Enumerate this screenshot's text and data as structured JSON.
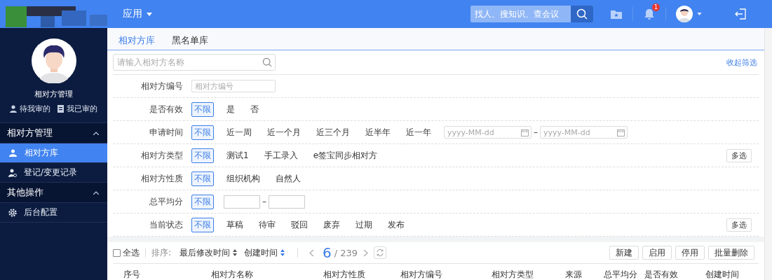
{
  "topbar": {
    "menu": "应用",
    "search_placeholder": "找人、搜知识、查会议",
    "notification_count": "1"
  },
  "sidebar": {
    "title": "相对方管理",
    "links": [
      "待我审的",
      "我已审的"
    ],
    "groups": [
      {
        "label": "相对方管理",
        "expanded": true,
        "items": [
          {
            "label": "相对方库",
            "selected": true
          },
          {
            "label": "登记/变更记录",
            "selected": false
          }
        ]
      },
      {
        "label": "其他操作",
        "expanded": true,
        "items": [
          {
            "label": "后台配置",
            "selected": false
          }
        ]
      }
    ]
  },
  "tabs": [
    {
      "label": "相对方库",
      "selected": true
    },
    {
      "label": "黑名单库",
      "selected": false
    }
  ],
  "search": {
    "placeholder": "请输入相对方名称"
  },
  "collapse_link": "收起筛选",
  "filters": [
    {
      "kind": "input",
      "label": "相对方编号",
      "placeholder": "相对方编号"
    },
    {
      "kind": "options",
      "label": "是否有效",
      "options": [
        {
          "label": "不限",
          "selected": true
        },
        {
          "label": "是",
          "selected": false
        },
        {
          "label": "否",
          "selected": false
        }
      ]
    },
    {
      "kind": "date",
      "label": "申请时间",
      "options": [
        {
          "label": "不限",
          "selected": true
        },
        {
          "label": "近一周",
          "selected": false
        },
        {
          "label": "近一个月",
          "selected": false
        },
        {
          "label": "近三个月",
          "selected": false
        },
        {
          "label": "近半年",
          "selected": false
        },
        {
          "label": "近一年",
          "selected": false
        }
      ],
      "from_placeholder": "yyyy-MM-dd",
      "separator": "–",
      "to_placeholder": "yyyy-MM-dd"
    },
    {
      "kind": "options",
      "label": "相对方类型",
      "options": [
        {
          "label": "不限",
          "selected": true
        },
        {
          "label": "测试1",
          "selected": false
        },
        {
          "label": "手工录入",
          "selected": false
        },
        {
          "label": "e签宝同步相对方",
          "selected": false
        }
      ],
      "multi_button": "多选"
    },
    {
      "kind": "options",
      "label": "相对方性质",
      "options": [
        {
          "label": "不限",
          "selected": true
        },
        {
          "label": "组织机构",
          "selected": false
        },
        {
          "label": "自然人",
          "selected": false
        }
      ]
    },
    {
      "kind": "range",
      "label": "总平均分",
      "options": [
        {
          "label": "不限",
          "selected": true
        }
      ],
      "separator": "–"
    },
    {
      "kind": "options",
      "label": "当前状态",
      "options": [
        {
          "label": "不限",
          "selected": true
        },
        {
          "label": "草稿",
          "selected": false
        },
        {
          "label": "待审",
          "selected": false
        },
        {
          "label": "驳回",
          "selected": false
        },
        {
          "label": "废弃",
          "selected": false
        },
        {
          "label": "过期",
          "selected": false
        },
        {
          "label": "发布",
          "selected": false
        }
      ],
      "multi_button": "多选"
    }
  ],
  "toolbar": {
    "select_all": {
      "label": "全选",
      "checked": false
    },
    "sort_label": "排序:",
    "sorts": [
      {
        "label": "最后修改时间",
        "active": false
      },
      {
        "label": "创建时间",
        "active": true
      }
    ],
    "page": "6",
    "total": "/ 239",
    "buttons": [
      "新建",
      "启用",
      "停用",
      "批量删除"
    ]
  },
  "table": {
    "columns": [
      "序号",
      "相对方名称",
      "相对方性质",
      "相对方编号",
      "相对方类型",
      "来源",
      "总平均分",
      "是否有效",
      "创建时间"
    ]
  }
}
